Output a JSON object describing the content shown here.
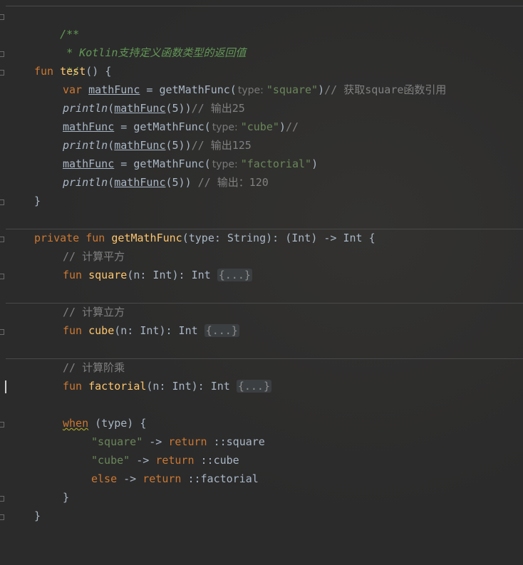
{
  "code": {
    "doc_open": "/**",
    "doc_text": " * Kotlin支持定义函数类型的返回值",
    "doc_close": " */",
    "fun_kw": "fun",
    "test_name": "test",
    "test_params": "() {",
    "var_kw": "var",
    "var_name": "mathFunc",
    "assign": " = ",
    "call_name": "getMathFunc(",
    "hint_label": "type:",
    "arg_square": "\"square\"",
    "close_paren": ")",
    "comment_square": "// 获取square函数引用",
    "println": "println",
    "open_paren": "(",
    "mathfunc_call": "mathFunc",
    "arg_five": "(5))",
    "comment_25": "// 输出25",
    "arg_cube": "\"cube\"",
    "comment_empty": "//",
    "comment_125": "// 输出125",
    "arg_factorial": "\"factorial\"",
    "comment_120": "// 输出：120",
    "close_brace": "}",
    "private_kw": "private",
    "getmathfunc_name": "getMathFunc",
    "getmathfunc_sig": "(type: String): (Int) -> Int {",
    "comment_square_fn": "// 计算平方",
    "square_name": "square",
    "square_sig": "(n: Int): Int ",
    "fold_placeholder": "{...}",
    "comment_cube_fn": "// 计算立方",
    "cube_name": "cube",
    "cube_sig": "(n: Int): Int ",
    "comment_factorial_fn": "// 计算阶乘",
    "factorial_name": "factorial",
    "factorial_sig": "(n: Int): Int ",
    "when_kw": "when",
    "when_sig": " (type) {",
    "case_square": "\"square\"",
    "arrow": " -> ",
    "return_kw": "return",
    "ref_square": " ::square",
    "case_cube": "\"cube\"",
    "ref_cube": " ::cube",
    "else_kw": "else",
    "ref_factorial": " ::factorial"
  }
}
